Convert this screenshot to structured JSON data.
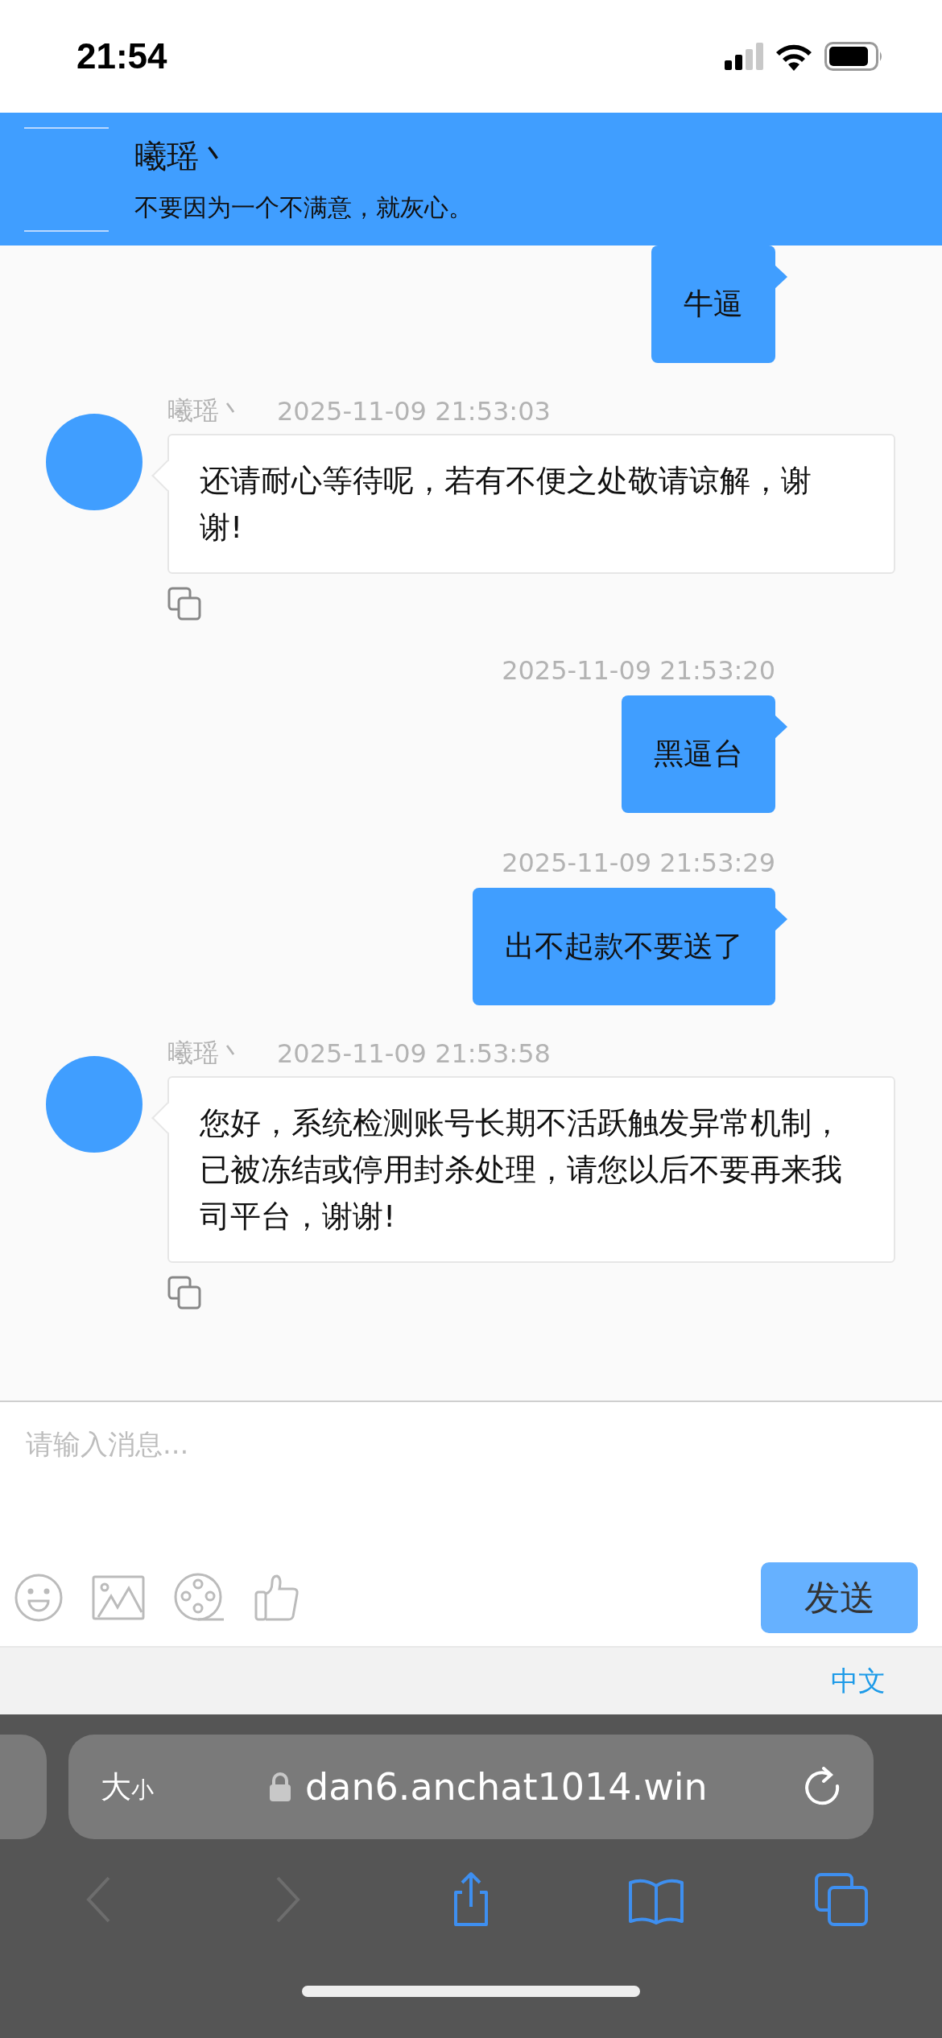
{
  "status_bar": {
    "time": "21:54"
  },
  "header": {
    "name": "曦瑶丶",
    "motto": "不要因为一个不满意，就灰心。"
  },
  "messages": [
    {
      "kind": "outgoing",
      "text": "牛逼"
    },
    {
      "kind": "incoming",
      "sender": "曦瑶丶",
      "time": "2025-11-09 21:53:03",
      "text": "还请耐心等待呢，若有不便之处敬请谅解，谢谢!"
    },
    {
      "kind": "outgoing",
      "time": "2025-11-09 21:53:20",
      "text": "黑逼台"
    },
    {
      "kind": "outgoing",
      "time": "2025-11-09 21:53:29",
      "text": "出不起款不要送了"
    },
    {
      "kind": "incoming",
      "sender": "曦瑶丶",
      "time": "2025-11-09 21:53:58",
      "text": "您好，系统检测账号长期不活跃触发异常机制，已被冻结或停用封杀处理，请您以后不要再来我司平台，谢谢!"
    }
  ],
  "composer": {
    "placeholder": "请输入消息...",
    "send": "发送"
  },
  "language": "中文",
  "browser": {
    "text_size": {
      "large": "大",
      "small": "小"
    },
    "url": "dan6.anchat1014.win",
    "back": {
      "disabled": true
    },
    "forward": {
      "disabled": true
    }
  }
}
